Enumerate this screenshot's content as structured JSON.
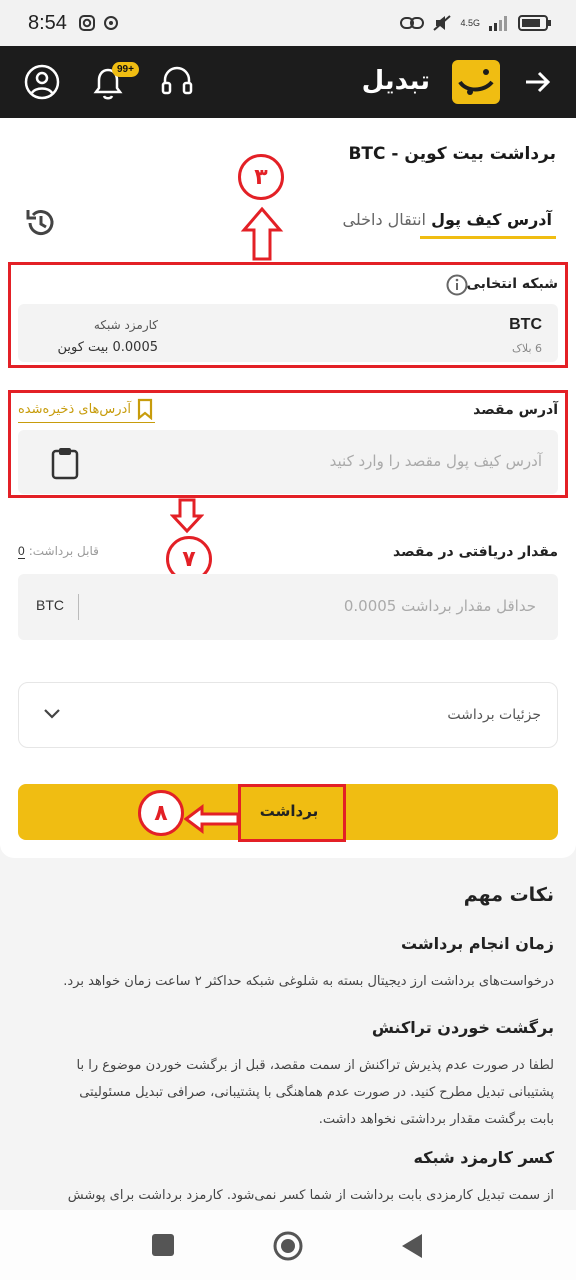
{
  "status_bar": {
    "time": "8:54",
    "network_label": "4.5G"
  },
  "app_bar": {
    "brand_name": "تبدیل",
    "notification_badge": "99+"
  },
  "page": {
    "title": "برداشت بیت کوین - BTC"
  },
  "tabs": [
    {
      "label": "آدرس کیف پول",
      "active": true
    },
    {
      "label": "انتقال داخلی",
      "active": false
    }
  ],
  "network": {
    "label": "شبکه انتخابی",
    "name": "BTC",
    "blocks": "6 بلاک",
    "fee_label": "کارمزد شبکه",
    "fee_value": "0.0005 بیت کوین"
  },
  "destination": {
    "label": "آدرس مقصد",
    "saved_link": "آدرس‌های ذخیره‌شده",
    "placeholder": "آدرس کیف پول مقصد را وارد کنید"
  },
  "amount": {
    "label": "مقدار دریافتی در مقصد",
    "available_label": "قابل برداشت:",
    "available_value": "0",
    "placeholder": "حداقل مقدار برداشت 0.0005",
    "unit": "BTC"
  },
  "details": {
    "label": "جزئیات برداشت"
  },
  "withdraw_button": {
    "label": "برداشت"
  },
  "annotations": {
    "three": "۳",
    "seven": "۷",
    "eight": "۸"
  },
  "notes": {
    "title": "نکات مهم",
    "sections": [
      {
        "heading": "زمان انجام برداشت",
        "lines": [
          "درخواست‌های برداشت ارز دیجیتال بسته به شلوغی شبکه حداکثر ۲ ساعت زمان خواهد برد."
        ]
      },
      {
        "heading": "برگشت خوردن تراکنش",
        "lines": [
          "لطفا در صورت عدم پذیرش تراکنش از سمت مقصد، قبل از برگشت خوردن موضوع را با",
          "پشتیبانی تبدیل مطرح کنید. در صورت عدم هماهنگی با پشتیبانی، صرافی تبدیل مسئولیتی",
          "بابت برگشت مقدار برداشتی نخواهد داشت."
        ]
      },
      {
        "heading": "کسر کارمزد شبکه",
        "lines": [
          "از سمت تبدیل کارمزدی بابت برداشت از شما کسر نمی‌شود. کارمزد برداشت برای پوشش"
        ]
      }
    ]
  },
  "colors": {
    "accent": "#f0bd12",
    "annotation_red": "#e32026",
    "appbar": "#1c1c1c"
  }
}
